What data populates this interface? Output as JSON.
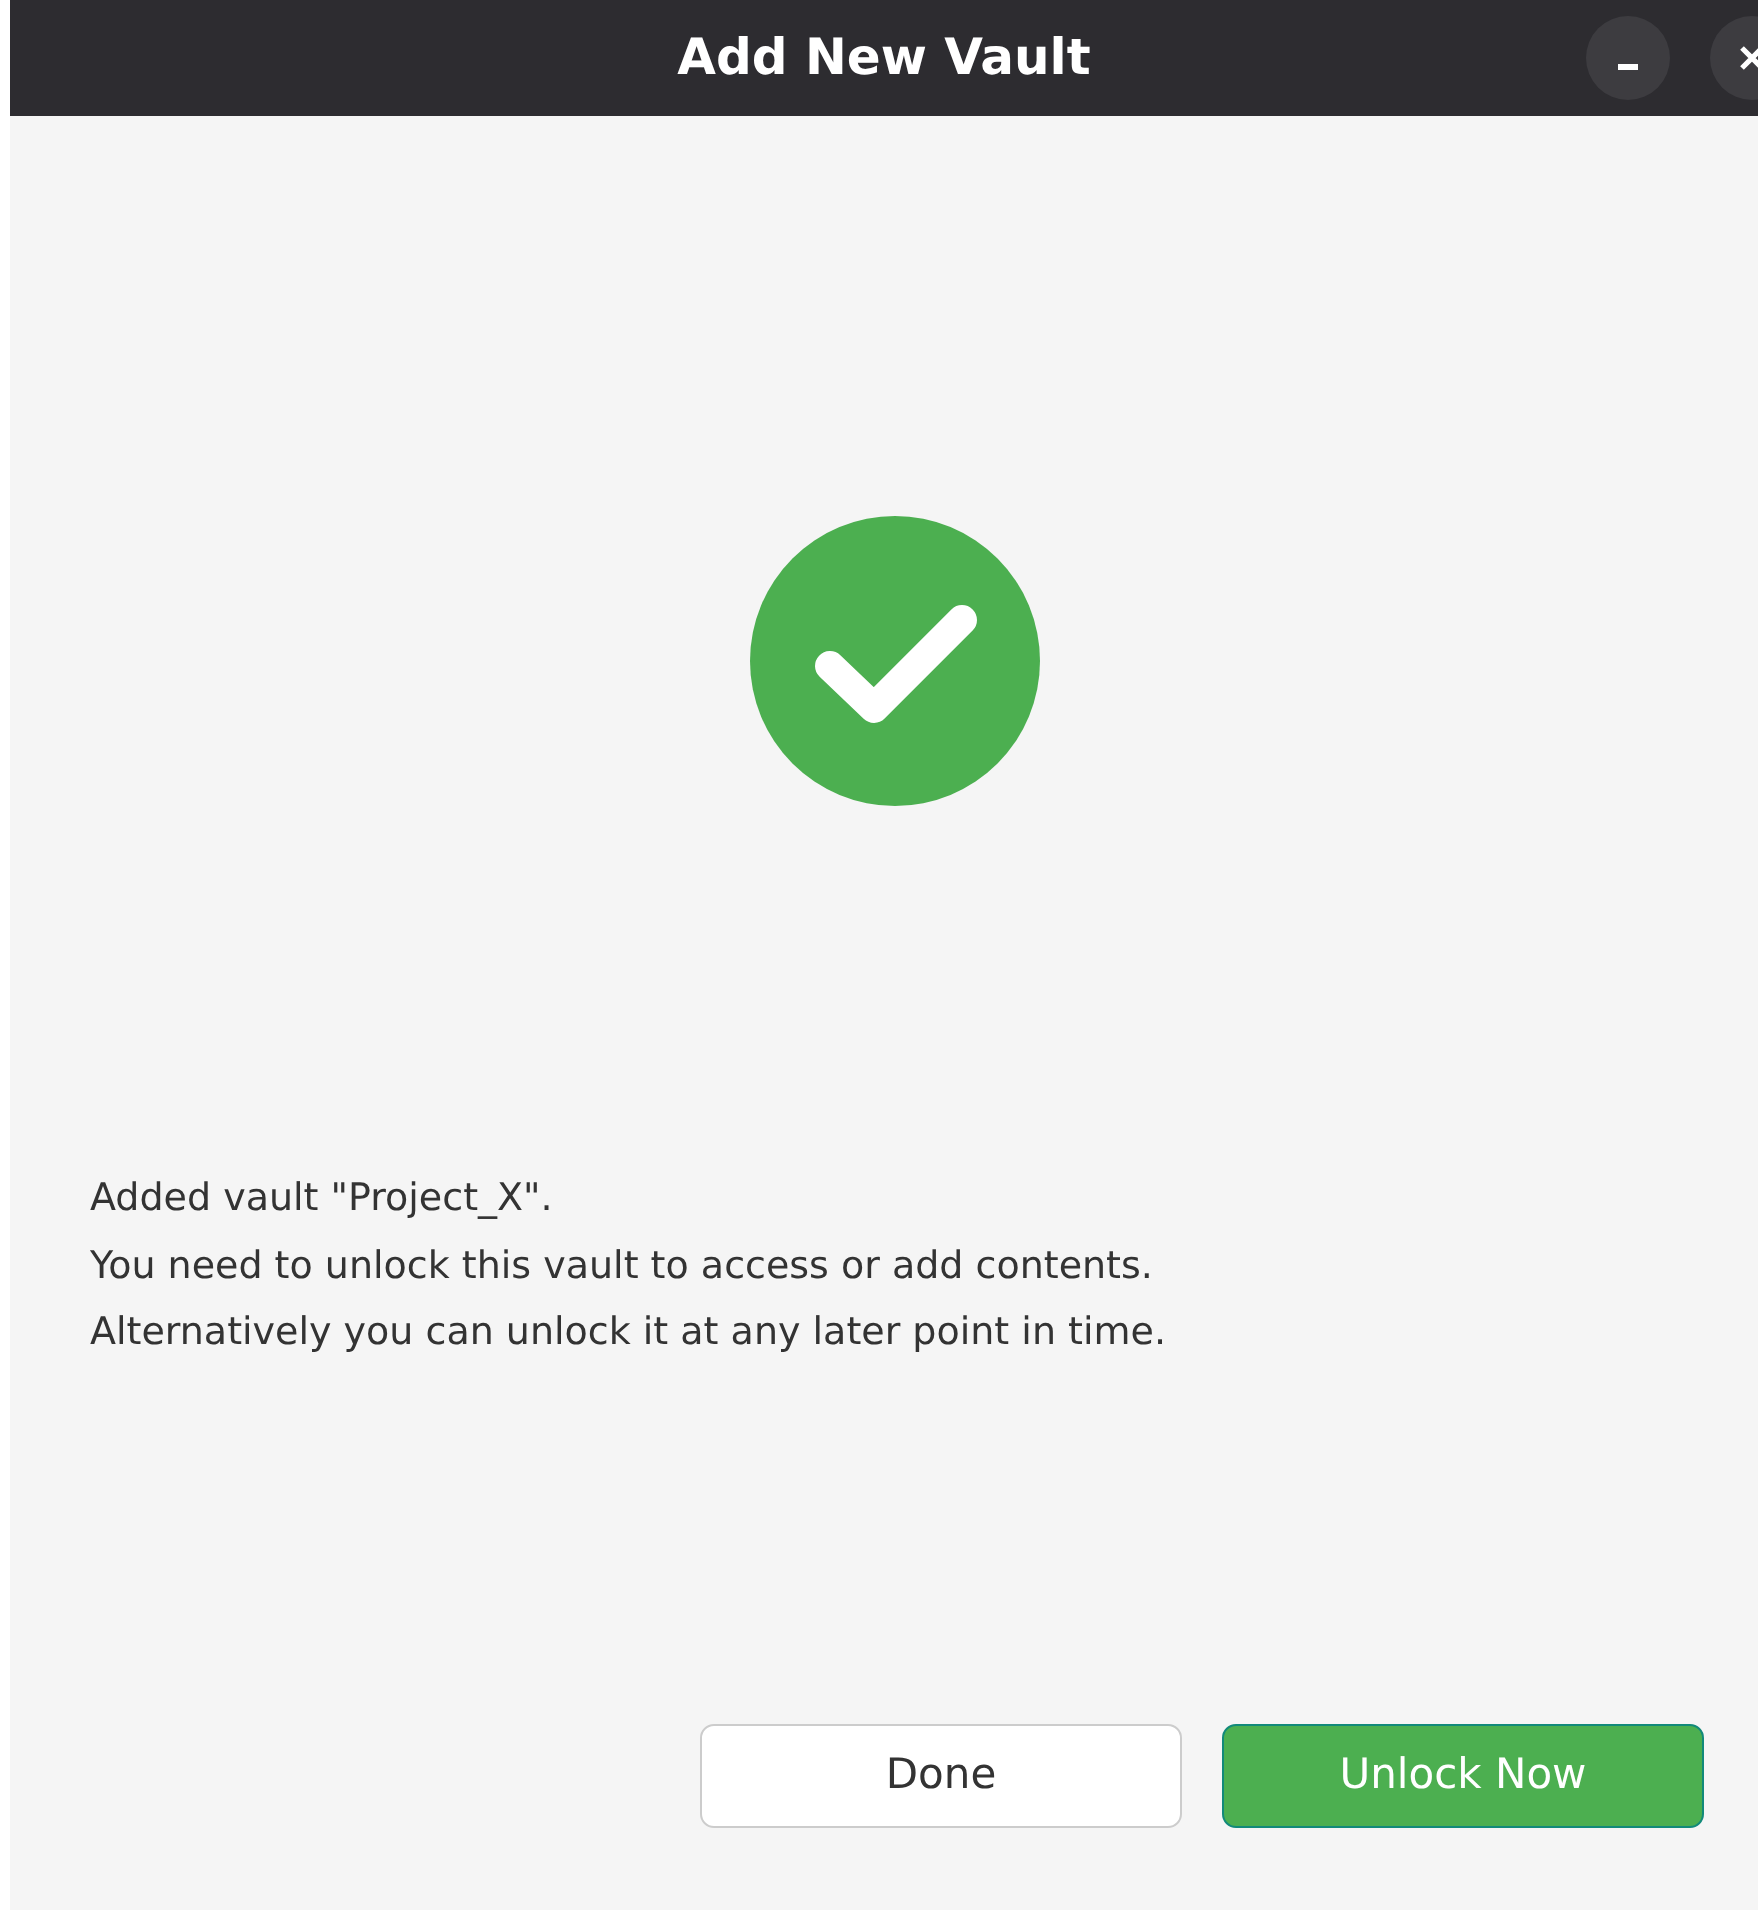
{
  "window": {
    "title": "Add New Vault"
  },
  "message": [
    "Added vault \"Project_X\".",
    "You need to unlock this vault to access or add contents.",
    "Alternatively you can unlock it at any later point in time."
  ],
  "buttons": [
    {
      "label": "Done",
      "kind": "secondary"
    },
    {
      "label": "Unlock Now",
      "kind": "primary"
    }
  ]
}
